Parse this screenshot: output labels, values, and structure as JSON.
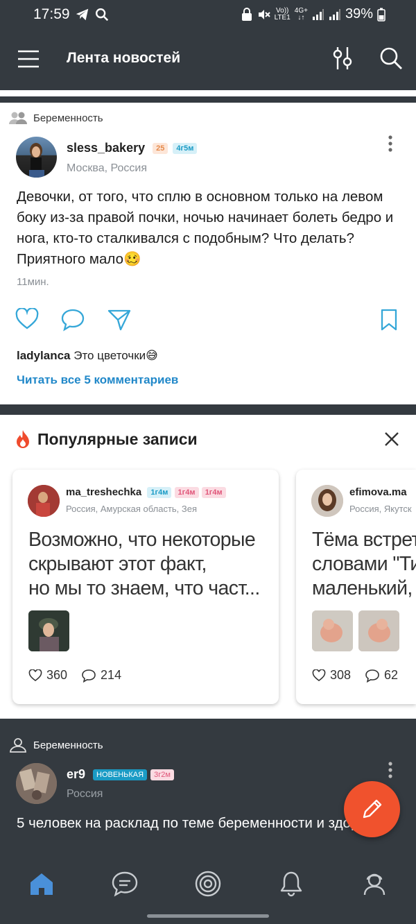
{
  "status_bar": {
    "time": "17:59",
    "icons": [
      "telegram-icon",
      "search-icon",
      "lock-icon",
      "mute-icon",
      "volte-icon",
      "network-4g-icon",
      "signal-icon",
      "signal-icon",
      "battery-icon"
    ],
    "volte_line1": "Vo))",
    "volte_line2": "LTE1",
    "net_line1": "4G+",
    "battery": "39%"
  },
  "app_bar": {
    "title": "Лента новостей",
    "menu_icon": "hamburger-icon",
    "filter_icon": "filter-icon",
    "search_icon": "search-icon"
  },
  "post1": {
    "group": "Беременность",
    "username": "sless_bakery",
    "badge_age": "25",
    "badge_child": "4г5м",
    "location": "Москва, Россия",
    "text": "Девочки, от того, что сплю в основном только на левом боку из-за правой почки, ночью начинает болеть бедро и нога, кто-то сталкивался с подобным? Что делать? Приятного мало",
    "emoji": "🥴",
    "time": "11мин.",
    "comment_author": "ladylanca",
    "comment_text": "Это цветочки",
    "comment_emoji": "😅",
    "read_all": "Читать все 5 комментариев"
  },
  "popular": {
    "title": "Популярные записи",
    "cards": [
      {
        "username": "ma_treshechka",
        "badges": [
          "1г4м",
          "1г4м",
          "1г4м"
        ],
        "location": "Россия, Амурская область, Зея",
        "text_lines": [
          "Возможно, что некоторые",
          "скрывают этот факт,",
          "но мы то знаем, что част..."
        ],
        "likes": "360",
        "comments": "214"
      },
      {
        "username": "efimova.ma",
        "location": "Россия, Якутск",
        "text_lines": [
          "Тёма встрет",
          "словами \"Ти",
          "маленький,"
        ],
        "likes": "308",
        "comments": "62"
      }
    ]
  },
  "post2": {
    "group": "Беременность",
    "username": "er9",
    "badge_new": "НОВЕНЬКАЯ",
    "badge_child": "3г2м",
    "location": "Россия",
    "text": "5 человек на расклад по теме беременности и здоровья."
  },
  "bottom_nav": [
    "home-icon",
    "chat-icon",
    "target-icon",
    "bell-icon",
    "profile-icon"
  ],
  "colors": {
    "dark_bg": "#343a40",
    "link_blue": "#2188c9",
    "fab_orange": "#f0522d"
  }
}
